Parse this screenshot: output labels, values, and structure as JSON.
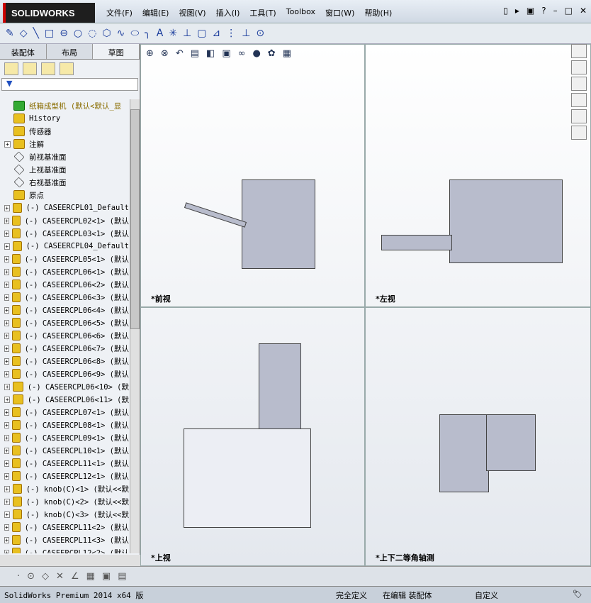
{
  "app": {
    "logo": "SOLIDWORKS"
  },
  "menu": [
    "文件(F)",
    "编辑(E)",
    "视图(V)",
    "插入(I)",
    "工具(T)",
    "Toolbox",
    "窗口(W)",
    "帮助(H)"
  ],
  "left_tabs": [
    "装配体",
    "布局",
    "草图"
  ],
  "tree": [
    {
      "label": "纸箱成型机   (默认<默认_显",
      "type": "root",
      "exp": false
    },
    {
      "label": "History",
      "type": "f",
      "exp": false
    },
    {
      "label": "传感器",
      "type": "f",
      "exp": false
    },
    {
      "label": "注解",
      "type": "f",
      "exp": true
    },
    {
      "label": "前视基准面",
      "type": "pl",
      "exp": false
    },
    {
      "label": "上视基准面",
      "type": "pl",
      "exp": false
    },
    {
      "label": "右视基准面",
      "type": "pl",
      "exp": false
    },
    {
      "label": "原点",
      "type": "o",
      "exp": false
    },
    {
      "label": "(-) CASEERCPL01_Default",
      "exp": true
    },
    {
      "label": "(-) CASEERCPL02<1> (默认",
      "exp": true
    },
    {
      "label": "(-) CASEERCPL03<1> (默认",
      "exp": true
    },
    {
      "label": "(-) CASEERCPL04_Default",
      "exp": true
    },
    {
      "label": "(-) CASEERCPL05<1> (默认",
      "exp": true
    },
    {
      "label": "(-) CASEERCPL06<1> (默认",
      "exp": true
    },
    {
      "label": "(-) CASEERCPL06<2> (默认",
      "exp": true
    },
    {
      "label": "(-) CASEERCPL06<3> (默认",
      "exp": true
    },
    {
      "label": "(-) CASEERCPL06<4> (默认",
      "exp": true
    },
    {
      "label": "(-) CASEERCPL06<5> (默认",
      "exp": true
    },
    {
      "label": "(-) CASEERCPL06<6> (默认",
      "exp": true
    },
    {
      "label": "(-) CASEERCPL06<7> (默认",
      "exp": true
    },
    {
      "label": "(-) CASEERCPL06<8> (默认",
      "exp": true
    },
    {
      "label": "(-) CASEERCPL06<9> (默认",
      "exp": true
    },
    {
      "label": "(-) CASEERCPL06<10> (默",
      "exp": true
    },
    {
      "label": "(-) CASEERCPL06<11> (默",
      "exp": true
    },
    {
      "label": "(-) CASEERCPL07<1> (默认",
      "exp": true
    },
    {
      "label": "(-) CASEERCPL08<1> (默认",
      "exp": true
    },
    {
      "label": "(-) CASEERCPL09<1> (默认",
      "exp": true
    },
    {
      "label": "(-) CASEERCPL10<1> (默认",
      "exp": true
    },
    {
      "label": "(-) CASEERCPL11<1> (默认",
      "exp": true
    },
    {
      "label": "(-) CASEERCPL12<1> (默认",
      "exp": true
    },
    {
      "label": "(-) knob(C)<1> (默认<<默",
      "exp": true
    },
    {
      "label": "(-) knob(C)<2> (默认<<默",
      "exp": true
    },
    {
      "label": "(-) knob(C)<3> (默认<<默",
      "exp": true
    },
    {
      "label": "(-) CASEERCPL11<2> (默认",
      "exp": true
    },
    {
      "label": "(-) CASEERCPL11<3> (默认",
      "exp": true
    },
    {
      "label": "(-) CASEERCPL12<2> (默认",
      "exp": true
    }
  ],
  "views": {
    "front": "*前视",
    "left": "*左视",
    "top": "*上视",
    "iso": "*上下二等角轴测"
  },
  "status": {
    "product": "SolidWorks Premium 2014 x64 版",
    "defined": "完全定义",
    "editing": "在编辑 装配体",
    "units": "自定义"
  }
}
